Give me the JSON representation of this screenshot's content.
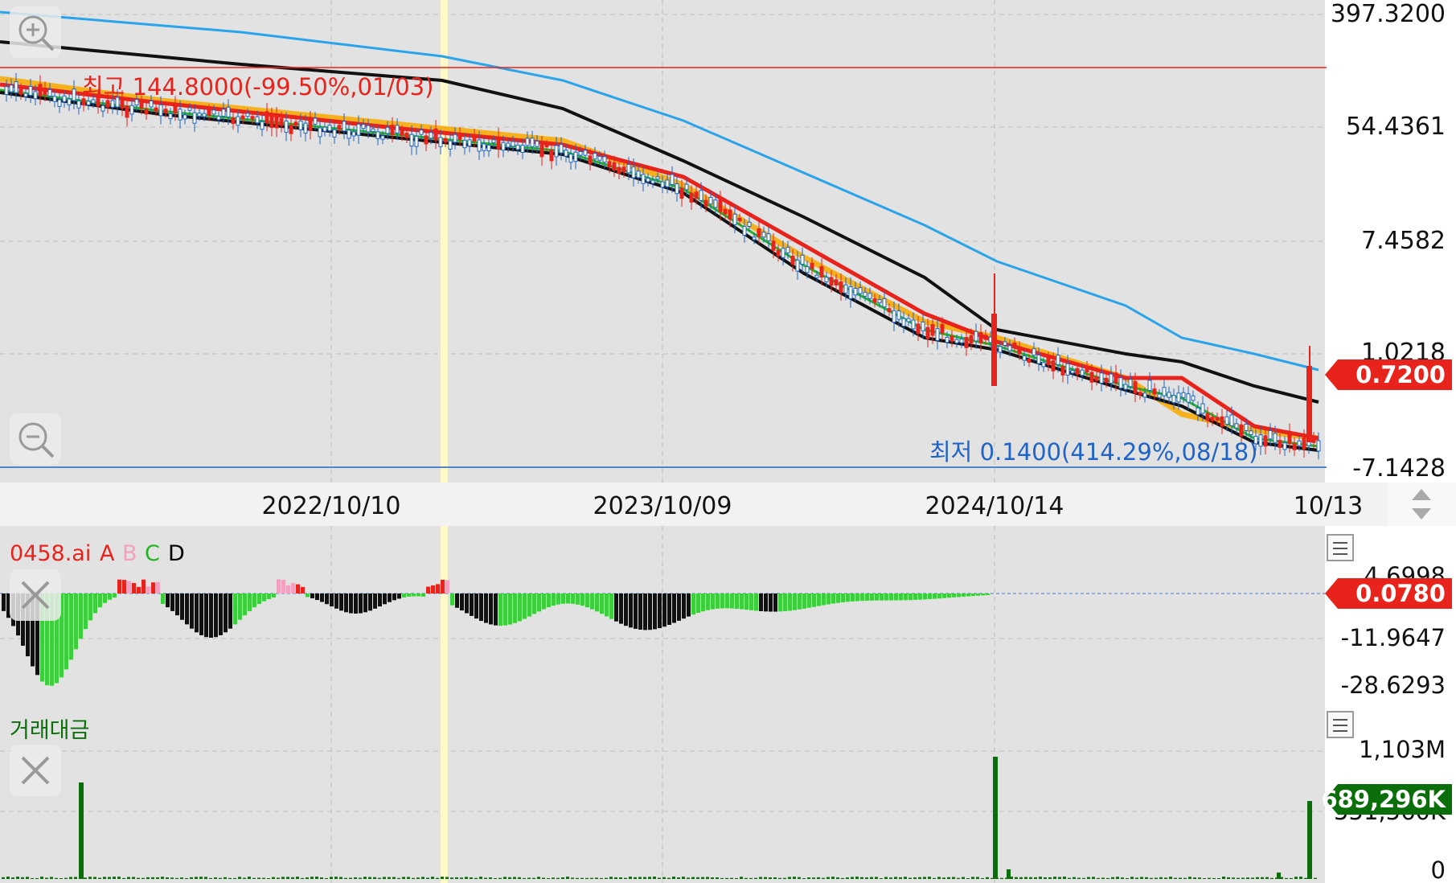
{
  "price_axis": {
    "labels": [
      "397.3200",
      "54.4361",
      "7.4582",
      "1.0218",
      "-7.1428"
    ]
  },
  "current_price": {
    "value": "0.7200",
    "color": "#e8231c"
  },
  "high_marker": {
    "text": "최고 144.8000(-99.50%,01/03)",
    "color": "#e8231c"
  },
  "low_marker": {
    "text": "최저 0.1400(414.29%,08/18)",
    "color": "#1e64c8"
  },
  "date_axis": {
    "labels": [
      "2022/10/10",
      "2023/10/09",
      "2024/10/14",
      "10/13"
    ]
  },
  "oscillator": {
    "title": "0458.ai",
    "legend": [
      "A",
      "B",
      "C",
      "D"
    ],
    "legend_colors": [
      "#e8231c",
      "#f4a0c0",
      "#22b422",
      "#000000"
    ],
    "axis_labels": [
      "4.6998",
      "-11.9647",
      "-28.6293"
    ],
    "current_value": "0.0780"
  },
  "volume": {
    "title": "거래대금",
    "axis_labels": [
      "1,103M",
      "551,560K",
      "0"
    ],
    "current_value": "689,296K",
    "color": "#0a6e0a"
  },
  "icons": [
    "zoom-in-icon",
    "zoom-out-icon",
    "close-icon",
    "menu-icon",
    "scroll-arrows-icon"
  ],
  "chart_data": {
    "type": "candlestick",
    "x_ticks": [
      "2022/10/10",
      "2023/10/09",
      "2024/10/14",
      "10/13"
    ],
    "y_scale": "log",
    "y_ticks": [
      397.32,
      54.4361,
      7.4582,
      1.0218,
      -7.1428
    ],
    "last_price": 0.72,
    "high": 144.8,
    "low": 0.14,
    "series": [
      {
        "color": "#29a3ea"
      },
      {
        "color": "#000000"
      },
      {
        "color": "#f5b21e"
      },
      {
        "color": "#e8231c"
      },
      {
        "color": "#22b422"
      }
    ]
  }
}
